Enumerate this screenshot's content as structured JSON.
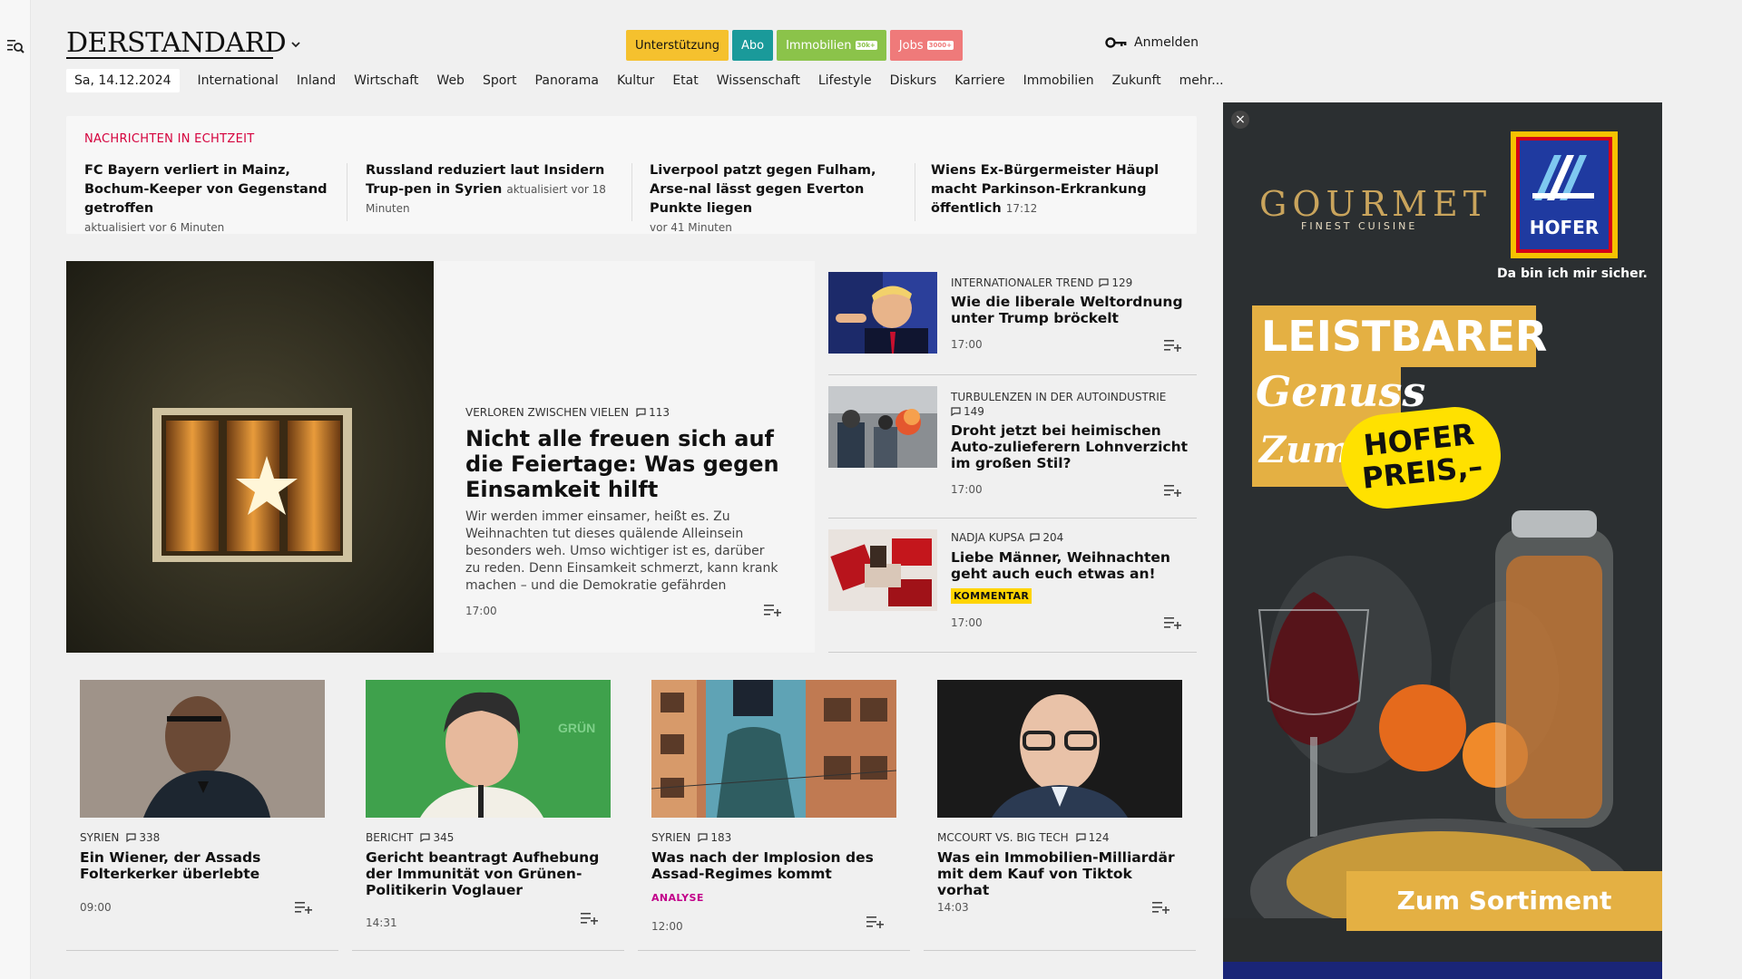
{
  "header": {
    "logo": "DERSTANDARD",
    "buttons": [
      {
        "label": "Unterstützung",
        "badge": "",
        "bg": "#f5c12e",
        "fg": "#111111"
      },
      {
        "label": "Abo",
        "badge": "",
        "bg": "#1a9a9a",
        "fg": "#ffffff"
      },
      {
        "label": "Immobilien",
        "badge": "30k+",
        "bg": "#8bc34a",
        "fg": "#ffffff"
      },
      {
        "label": "Jobs",
        "badge": "3000+",
        "bg": "#ef7a7a",
        "fg": "#ffffff"
      }
    ],
    "login_label": "Anmelden"
  },
  "nav": {
    "date": "Sa, 14.12.2024",
    "items": [
      "International",
      "Inland",
      "Wirtschaft",
      "Web",
      "Sport",
      "Panorama",
      "Kultur",
      "Etat",
      "Wissenschaft",
      "Lifestyle",
      "Diskurs",
      "Karriere",
      "Immobilien",
      "Zukunft",
      "mehr..."
    ]
  },
  "ticker": {
    "heading": "NACHRICHTEN IN ECHTZEIT",
    "items": [
      {
        "title": "FC Bayern verliert in Mainz, Bochum-Keeper von Gegenstand getroffen",
        "meta": "aktualisiert vor 6 Minuten"
      },
      {
        "title": "Russland reduziert laut Insidern Trup-pen in Syrien",
        "meta": "aktualisiert vor 18 Minuten"
      },
      {
        "title": "Liverpool patzt gegen Fulham, Arse-nal lässt gegen Everton Punkte liegen",
        "meta": "vor 41 Minuten"
      },
      {
        "title": "Wiens Ex-Bürgermeister Häupl macht Parkinson-Erkrankung öffentlich",
        "meta": "17:12"
      }
    ]
  },
  "lead": {
    "kicker": "VERLOREN ZWISCHEN VIELEN",
    "comments": "113",
    "title": "Nicht alle freuen sich auf die Feiertage: Was gegen Einsamkeit hilft",
    "teaser": "Wir werden immer einsamer, heißt es. Zu Weihnachten tut dieses quälende Alleinsein besonders weh. Umso wichtiger ist es, darüber zu reden. Denn Einsamkeit schmerzt, kann krank machen – und die Demokratie gefährden",
    "time": "17:00"
  },
  "side": [
    {
      "kicker": "INTERNATIONALER TREND",
      "comments": "129",
      "title": "Wie die liberale Weltordnung unter Trump bröckelt",
      "tag": "",
      "time": "17:00"
    },
    {
      "kicker": "TURBULENZEN IN DER AUTOINDUSTRIE",
      "comments": "149",
      "title": "Droht jetzt bei heimischen Auto-zulieferern Lohnverzicht im großen Stil?",
      "tag": "",
      "time": "17:00"
    },
    {
      "kicker": "NADJA KUPSA",
      "comments": "204",
      "title": "Liebe Männer, Weihnachten geht auch euch etwas an!",
      "tag": "KOMMENTAR",
      "time": "17:00"
    }
  ],
  "bottom": [
    {
      "kicker": "SYRIEN",
      "comments": "338",
      "title": "Ein Wiener, der Assads Folterkerker überlebte",
      "tag": "",
      "time": "09:00"
    },
    {
      "kicker": "BERICHT",
      "comments": "345",
      "title": "Gericht beantragt Aufhebung der Immunität von Grünen-Politikerin Voglauer",
      "tag": "",
      "time": "14:31"
    },
    {
      "kicker": "SYRIEN",
      "comments": "183",
      "title": "Was nach der Implosion des Assad-Regimes kommt",
      "tag": "ANALYSE",
      "time": "12:00"
    },
    {
      "kicker": "MCCOURT VS. BIG TECH",
      "comments": "124",
      "title": "Was ein Immobilien-Milliardär mit dem Kauf von Tiktok vorhat",
      "tag": "",
      "time": "14:03"
    }
  ],
  "ad": {
    "close": "×",
    "gourmet": "GOURMET",
    "gourmet_sub": "FINEST CUISINE",
    "hofer": "HOFER",
    "slogan": "Da bin ich mir sicher.",
    "headline": "LEISTBARER",
    "line2": "Genuss",
    "line3": "Zum",
    "badge": "HOFER PREIS,–",
    "cta": "Zum Sortiment"
  },
  "colors": {
    "accent_red": "#d5003c",
    "kommentar_tag": "#ffd400",
    "analyse_tag": "#c2008a"
  }
}
